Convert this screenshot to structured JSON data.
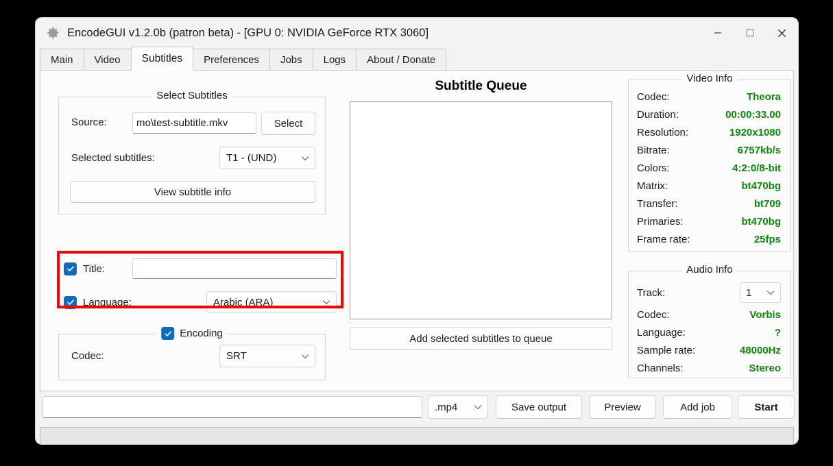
{
  "window": {
    "title": "EncodeGUI v1.2.0b (patron beta) - [GPU 0: NVIDIA GeForce RTX 3060]",
    "app_icon": "gear-icon",
    "controls": {
      "minimize": "minimize-icon",
      "maximize": "maximize-icon",
      "close": "close-icon"
    }
  },
  "tabs": [
    {
      "label": "Main",
      "active": false
    },
    {
      "label": "Video",
      "active": false
    },
    {
      "label": "Subtitles",
      "active": true
    },
    {
      "label": "Preferences",
      "active": false
    },
    {
      "label": "Jobs",
      "active": false
    },
    {
      "label": "Logs",
      "active": false
    },
    {
      "label": "About / Donate",
      "active": false
    }
  ],
  "select_subtitles": {
    "group_title": "Select Subtitles",
    "source_label": "Source:",
    "source_value": "mo\\test-subtitle.mkv",
    "source_placeholder": "",
    "select_button": "Select",
    "selected_label": "Selected subtitles:",
    "selected_value": "T1 - (UND)",
    "view_info_button": "View subtitle info"
  },
  "metadata": {
    "title_label": "Title:",
    "title_checked": true,
    "title_value": "",
    "title_placeholder": "",
    "language_label": "Language:",
    "language_checked": true,
    "language_value": "Arabic (ARA)",
    "highlight_color": "#ff0000"
  },
  "encoding": {
    "group_title": "Encoding",
    "group_checked": true,
    "codec_label": "Codec:",
    "codec_value": "SRT"
  },
  "queue": {
    "title": "Subtitle Queue",
    "items": [],
    "add_button": "Add selected subtitles to queue"
  },
  "video_info": {
    "title": "Video Info",
    "rows": [
      {
        "key": "Codec:",
        "value": "Theora"
      },
      {
        "key": "Duration:",
        "value": "00:00:33.00"
      },
      {
        "key": "Resolution:",
        "value": "1920x1080"
      },
      {
        "key": "Bitrate:",
        "value": "6757kb/s"
      },
      {
        "key": "Colors:",
        "value": "4:2:0/8-bit"
      },
      {
        "key": "Matrix:",
        "value": "bt470bg"
      },
      {
        "key": "Transfer:",
        "value": "bt709"
      },
      {
        "key": "Primaries:",
        "value": "bt470bg"
      },
      {
        "key": "Frame rate:",
        "value": "25fps"
      }
    ],
    "value_color": "#0a8a0a"
  },
  "audio_info": {
    "title": "Audio Info",
    "track_label": "Track:",
    "track_value": "1",
    "rows": [
      {
        "key": "Codec:",
        "value": "Vorbis"
      },
      {
        "key": "Language:",
        "value": "?"
      },
      {
        "key": "Sample rate:",
        "value": "48000Hz"
      },
      {
        "key": "Channels:",
        "value": "Stereo"
      }
    ],
    "value_color": "#0a8a0a"
  },
  "bottom_bar": {
    "output_value": "",
    "output_placeholder": "",
    "container_value": ".mp4",
    "save_output_button": "Save output",
    "preview_button": "Preview",
    "add_job_button": "Add job",
    "start_button": "Start"
  },
  "status_bar": {
    "text": ""
  }
}
